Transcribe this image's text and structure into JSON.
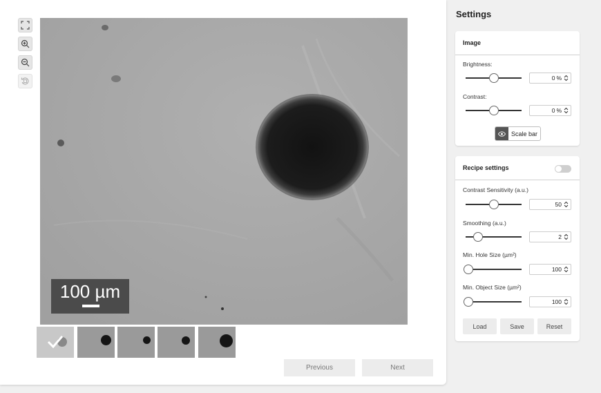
{
  "toolbar": {
    "tools": [
      {
        "icon": "fullscreen-icon"
      },
      {
        "icon": "zoom-in-icon"
      },
      {
        "icon": "zoom-out-icon"
      },
      {
        "icon": "reset-rotate-icon"
      }
    ]
  },
  "viewer": {
    "scale_bar_label": "100 µm"
  },
  "navigation": {
    "previous_label": "Previous",
    "next_label": "Next"
  },
  "settings": {
    "title": "Settings",
    "image": {
      "heading": "Image",
      "brightness_label": "Brightness:",
      "brightness_value": "0",
      "brightness_unit": "%",
      "contrast_label": "Contrast:",
      "contrast_value": "0",
      "contrast_unit": "%",
      "scale_bar_button": "Scale bar"
    },
    "recipe": {
      "heading": "Recipe settings",
      "contrast_sensitivity_label": "Contrast Sensitivity (a.u.)",
      "contrast_sensitivity_value": "50",
      "smoothing_label": "Smoothing (a.u.)",
      "smoothing_value": "2",
      "min_hole_label": "Min. Hole Size (µm²)",
      "min_hole_value": "100",
      "min_object_label": "Min. Object Size (µm²)",
      "min_object_value": "100",
      "load_label": "Load",
      "save_label": "Save",
      "reset_label": "Reset"
    }
  }
}
